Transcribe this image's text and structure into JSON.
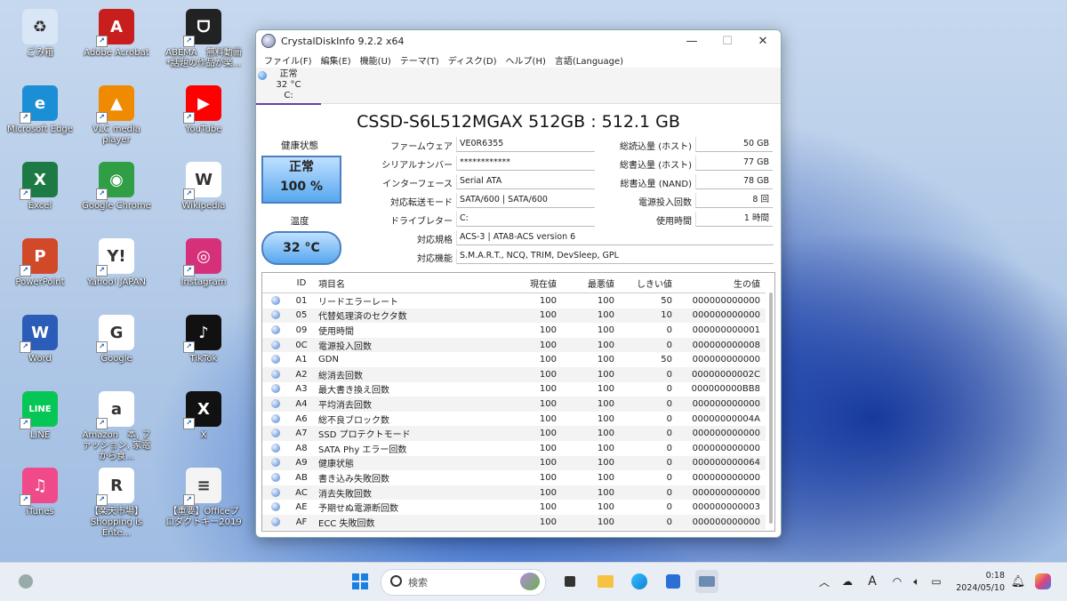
{
  "desktop": {
    "icons": [
      {
        "label": "ごみ箱",
        "icon": "recycle-bin-icon",
        "color": "#d9e6f5",
        "glyph": "♻"
      },
      {
        "label": "Adobe Acrobat",
        "icon": "acrobat-icon",
        "color": "#c81e1e",
        "glyph": "A"
      },
      {
        "label": "ABEMA　無料動画 *話題の作品が楽...",
        "icon": "abema-icon",
        "color": "#222222",
        "glyph": "ᗜ"
      },
      {
        "label": "Microsoft Edge",
        "icon": "edge-icon",
        "color": "#1b8fd6",
        "glyph": "e"
      },
      {
        "label": "VLC media player",
        "icon": "vlc-icon",
        "color": "#f08a00",
        "glyph": "▲"
      },
      {
        "label": "YouTube",
        "icon": "youtube-icon",
        "color": "#ff0000",
        "glyph": "▶"
      },
      {
        "label": "Excel",
        "icon": "excel-icon",
        "color": "#1d7a44",
        "glyph": "X"
      },
      {
        "label": "Google Chrome",
        "icon": "chrome-icon",
        "color": "#2f9e44",
        "glyph": "◉"
      },
      {
        "label": "Wikipedia",
        "icon": "wikipedia-icon",
        "color": "#ffffff",
        "glyph": "W"
      },
      {
        "label": "PowerPoint",
        "icon": "powerpoint-icon",
        "color": "#d2492a",
        "glyph": "P"
      },
      {
        "label": "Yahoo! JAPAN",
        "icon": "yahoo-icon",
        "color": "#ffffff",
        "glyph": "Y!"
      },
      {
        "label": "Instagram",
        "icon": "instagram-icon",
        "color": "#d6307a",
        "glyph": "◎"
      },
      {
        "label": "Word",
        "icon": "word-icon",
        "color": "#2b5cb8",
        "glyph": "W"
      },
      {
        "label": "Google",
        "icon": "google-icon",
        "color": "#ffffff",
        "glyph": "G"
      },
      {
        "label": "TikTok",
        "icon": "tiktok-icon",
        "color": "#111111",
        "glyph": "♪"
      },
      {
        "label": "LINE",
        "icon": "line-icon",
        "color": "#06c755",
        "glyph": "LINE"
      },
      {
        "label": "Amazon　本, ファッション, 家電から食...",
        "icon": "amazon-icon",
        "color": "#ffffff",
        "glyph": "a"
      },
      {
        "label": "X",
        "icon": "x-icon",
        "color": "#111111",
        "glyph": "X"
      },
      {
        "label": "iTunes",
        "icon": "itunes-icon",
        "color": "#f04a8a",
        "glyph": "♫"
      },
      {
        "label": "【楽天市場】 Shopping is Ente...",
        "icon": "rakuten-icon",
        "color": "#ffffff",
        "glyph": "R"
      },
      {
        "label": "【重要】Officeプロダクトキー2019",
        "icon": "document-icon",
        "color": "#f4f4f4",
        "glyph": "≡"
      }
    ]
  },
  "window": {
    "title": "CrystalDiskInfo 9.2.2 x64",
    "controls": {
      "minimize": "—",
      "maximize": "☐",
      "close": "✕"
    },
    "menu": [
      "ファイル(F)",
      "編集(E)",
      "機能(U)",
      "テーマ(T)",
      "ディスク(D)",
      "ヘルプ(H)",
      "言語(Language)"
    ],
    "disk_tab": {
      "status": "正常",
      "temp": "32 °C",
      "drive": "C:"
    },
    "model": "CSSD-S6L512MGAX 512GB : 512.1 GB",
    "health_label": "健康状態",
    "health_status": "正常",
    "health_percent": "100 %",
    "temp_label": "温度",
    "temp_value": "32 °C",
    "left_fields": [
      {
        "label": "ファームウェア",
        "value": "VE0R6355"
      },
      {
        "label": "シリアルナンバー",
        "value": "************"
      },
      {
        "label": "インターフェース",
        "value": "Serial ATA"
      },
      {
        "label": "対応転送モード",
        "value": "SATA/600 | SATA/600"
      },
      {
        "label": "ドライブレター",
        "value": "C:"
      }
    ],
    "right_fields": [
      {
        "label": "総読込量 (ホスト)",
        "value": "50 GB"
      },
      {
        "label": "総書込量 (ホスト)",
        "value": "77 GB"
      },
      {
        "label": "総書込量 (NAND)",
        "value": "78 GB"
      },
      {
        "label": "電源投入回数",
        "value": "8 回"
      },
      {
        "label": "使用時間",
        "value": "1 時間"
      }
    ],
    "standard": {
      "label": "対応規格",
      "value": "ACS-3 | ATA8-ACS version 6"
    },
    "features": {
      "label": "対応機能",
      "value": "S.M.A.R.T., NCQ, TRIM, DevSleep, GPL"
    },
    "smart_headers": [
      "ID",
      "項目名",
      "現在値",
      "最悪値",
      "しきい値",
      "生の値"
    ],
    "smart_rows": [
      [
        "01",
        "リードエラーレート",
        "100",
        "100",
        "50",
        "000000000000"
      ],
      [
        "05",
        "代替処理済のセクタ数",
        "100",
        "100",
        "10",
        "000000000000"
      ],
      [
        "09",
        "使用時間",
        "100",
        "100",
        "0",
        "000000000001"
      ],
      [
        "0C",
        "電源投入回数",
        "100",
        "100",
        "0",
        "000000000008"
      ],
      [
        "A1",
        "GDN",
        "100",
        "100",
        "50",
        "000000000000"
      ],
      [
        "A2",
        "総消去回数",
        "100",
        "100",
        "0",
        "00000000002C"
      ],
      [
        "A3",
        "最大書き換え回数",
        "100",
        "100",
        "0",
        "000000000BB8"
      ],
      [
        "A4",
        "平均消去回数",
        "100",
        "100",
        "0",
        "000000000000"
      ],
      [
        "A6",
        "総不良ブロック数",
        "100",
        "100",
        "0",
        "00000000004A"
      ],
      [
        "A7",
        "SSD プロテクトモード",
        "100",
        "100",
        "0",
        "000000000000"
      ],
      [
        "A8",
        "SATA Phy エラー回数",
        "100",
        "100",
        "0",
        "000000000000"
      ],
      [
        "A9",
        "健康状態",
        "100",
        "100",
        "0",
        "000000000064"
      ],
      [
        "AB",
        "書き込み失敗回数",
        "100",
        "100",
        "0",
        "000000000000"
      ],
      [
        "AC",
        "消去失敗回数",
        "100",
        "100",
        "0",
        "000000000000"
      ],
      [
        "AE",
        "予期せぬ電源断回数",
        "100",
        "100",
        "0",
        "000000000003"
      ],
      [
        "AF",
        "ECC 失敗回数",
        "100",
        "100",
        "0",
        "000000000000"
      ]
    ]
  },
  "taskbar": {
    "search_placeholder": "検索",
    "ime": "A",
    "time": "0:18",
    "date": "2024/05/10"
  }
}
